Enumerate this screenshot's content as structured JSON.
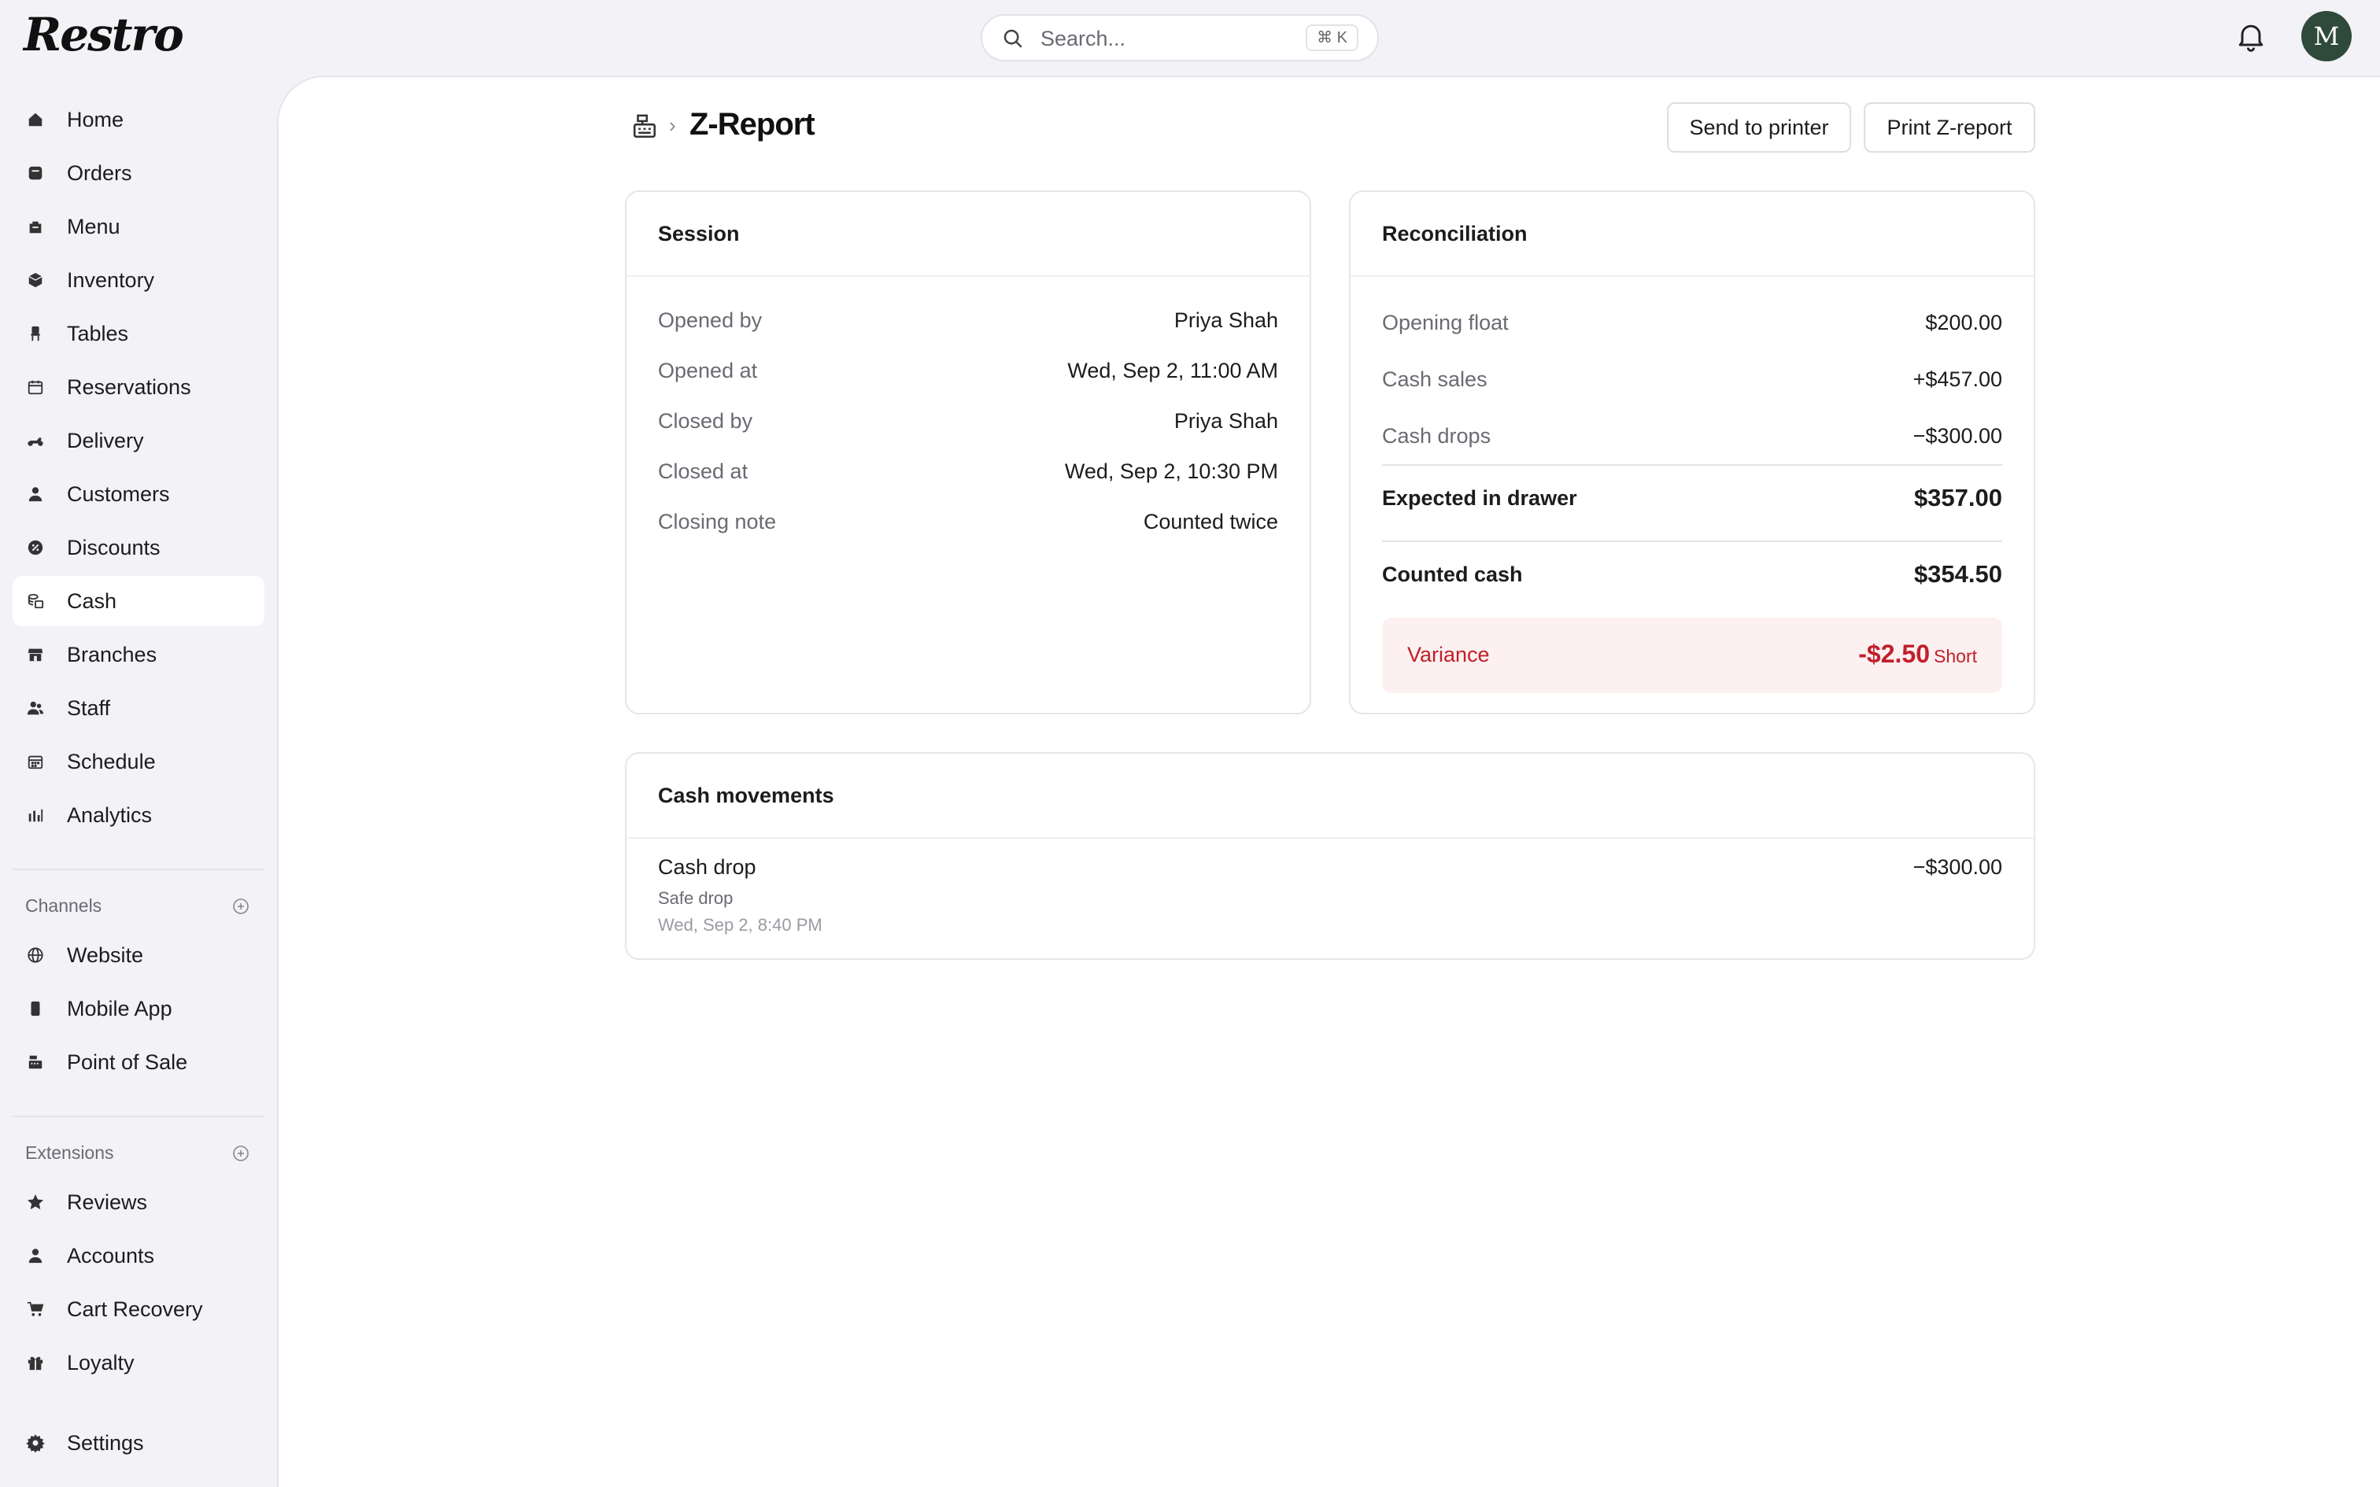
{
  "app": {
    "logo": "Restro",
    "avatar_initial": "M"
  },
  "search": {
    "placeholder": "Search...",
    "shortcut": "⌘ K"
  },
  "sidebar": {
    "items": [
      {
        "label": "Home",
        "icon": "home-icon"
      },
      {
        "label": "Orders",
        "icon": "orders-icon"
      },
      {
        "label": "Menu",
        "icon": "menu-icon"
      },
      {
        "label": "Inventory",
        "icon": "inventory-icon"
      },
      {
        "label": "Tables",
        "icon": "chair-icon"
      },
      {
        "label": "Reservations",
        "icon": "calendar-icon"
      },
      {
        "label": "Delivery",
        "icon": "scooter-icon"
      },
      {
        "label": "Customers",
        "icon": "user-icon"
      },
      {
        "label": "Discounts",
        "icon": "discount-icon"
      },
      {
        "label": "Cash",
        "icon": "cash-icon",
        "active": true
      },
      {
        "label": "Branches",
        "icon": "store-icon"
      },
      {
        "label": "Staff",
        "icon": "staff-icon"
      },
      {
        "label": "Schedule",
        "icon": "schedule-icon"
      },
      {
        "label": "Analytics",
        "icon": "analytics-icon"
      }
    ],
    "channels_title": "Channels",
    "channels": [
      {
        "label": "Website",
        "icon": "globe-icon"
      },
      {
        "label": "Mobile App",
        "icon": "phone-icon"
      },
      {
        "label": "Point of Sale",
        "icon": "register-icon"
      }
    ],
    "extensions_title": "Extensions",
    "extensions": [
      {
        "label": "Reviews",
        "icon": "star-icon"
      },
      {
        "label": "Accounts",
        "icon": "user-icon"
      },
      {
        "label": "Cart Recovery",
        "icon": "cart-icon"
      },
      {
        "label": "Loyalty",
        "icon": "gift-icon"
      }
    ],
    "settings": {
      "label": "Settings",
      "icon": "gear-icon"
    }
  },
  "page": {
    "title": "Z-Report",
    "send_button": "Send to printer",
    "print_button": "Print Z-report"
  },
  "session": {
    "title": "Session",
    "rows": [
      {
        "label": "Opened by",
        "value": "Priya Shah"
      },
      {
        "label": "Opened at",
        "value": "Wed, Sep 2, 11:00 AM"
      },
      {
        "label": "Closed by",
        "value": "Priya Shah"
      },
      {
        "label": "Closed at",
        "value": "Wed, Sep 2, 10:30 PM"
      },
      {
        "label": "Closing note",
        "value": "Counted twice"
      }
    ]
  },
  "reconciliation": {
    "title": "Reconciliation",
    "opening_float": {
      "label": "Opening float",
      "value": "$200.00"
    },
    "cash_sales": {
      "label": "Cash sales",
      "value": "+$457.00"
    },
    "cash_drops": {
      "label": "Cash drops",
      "value": "−$300.00"
    },
    "expected": {
      "label": "Expected in drawer",
      "value": "$357.00"
    },
    "counted": {
      "label": "Counted cash",
      "value": "$354.50"
    },
    "variance": {
      "label": "Variance",
      "value": "-$2.50",
      "tag": "Short"
    },
    "colors": {
      "variance_text": "#c0202a",
      "variance_bg": "#fdf0f0"
    }
  },
  "movements": {
    "title": "Cash movements",
    "items": [
      {
        "title": "Cash drop",
        "subtitle": "Safe drop",
        "time": "Wed, Sep 2, 8:40 PM",
        "amount": "−$300.00"
      }
    ]
  }
}
